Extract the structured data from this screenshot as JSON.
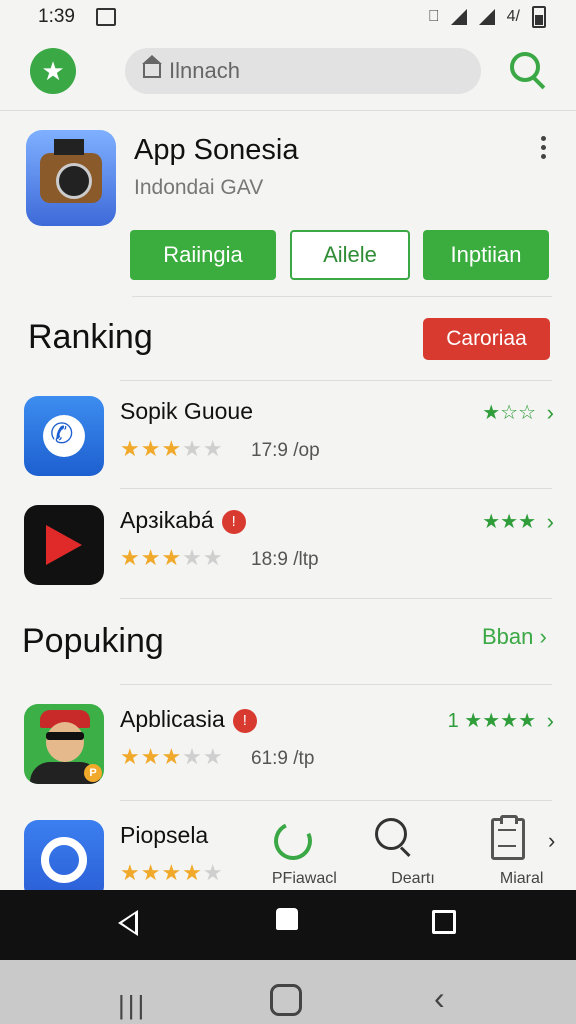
{
  "status_bar": {
    "time": "1:39",
    "battery_label": "4/"
  },
  "top_bar": {
    "search_placeholder": "Ilnnach"
  },
  "app": {
    "title": "App Sonesia",
    "subtitle": "Indondai GAV",
    "buttons": [
      "Raiingia",
      "Ailele",
      "Inptiian"
    ]
  },
  "ranking": {
    "heading": "Ranking",
    "category_button": "Caroriaa",
    "items": [
      {
        "name": "Sopik Guoue",
        "stars": 3.5,
        "meta": "17:9 /op",
        "rating_text": "★☆☆",
        "icon": "phone-icon"
      },
      {
        "name": "Apзikabá",
        "badge": "!",
        "stars": 3.5,
        "meta": "18:9 /ltp",
        "rating_text": "★★★",
        "icon": "play-icon"
      }
    ]
  },
  "popular": {
    "heading": "Popuking",
    "see_all": "Bban",
    "items": [
      {
        "name": "Apblicasia",
        "badge": "!",
        "stars": 3.5,
        "meta": "61:9 /tp",
        "rating_text": "1 ★★★★",
        "icon": "avatar-icon"
      },
      {
        "name": "Piopsela",
        "stars": 4,
        "meta": "",
        "rating_text": "",
        "icon": "chat-icon"
      }
    ]
  },
  "bottom_tabs": [
    {
      "label": "PFiawacl",
      "icon": "refresh-icon"
    },
    {
      "label": "Deartı",
      "icon": "search-icon"
    },
    {
      "label": "Miaral",
      "icon": "clipboard-icon"
    }
  ],
  "colors": {
    "accent": "#3aad3e",
    "danger": "#d93a2f",
    "star": "#f0a92a"
  }
}
